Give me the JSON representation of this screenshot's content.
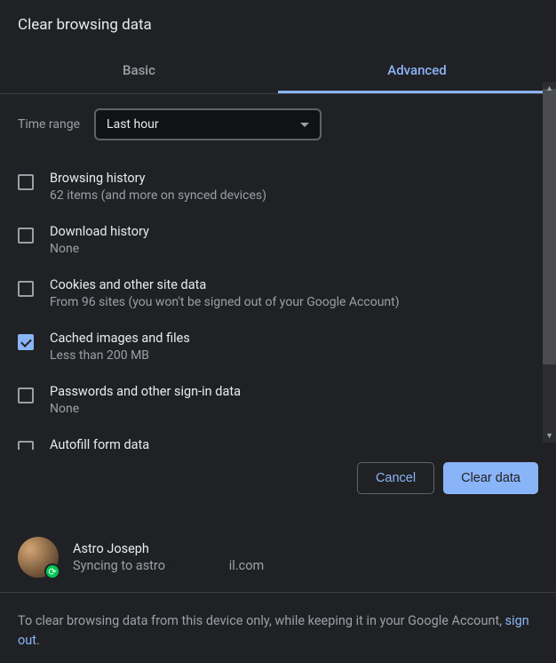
{
  "title": "Clear browsing data",
  "tabs": {
    "basic": "Basic",
    "advanced": "Advanced"
  },
  "time_range": {
    "label": "Time range",
    "value": "Last hour"
  },
  "items": [
    {
      "title": "Browsing history",
      "sub": "62 items (and more on synced devices)",
      "checked": false
    },
    {
      "title": "Download history",
      "sub": "None",
      "checked": false
    },
    {
      "title": "Cookies and other site data",
      "sub": "From 96 sites (you won't be signed out of your Google Account)",
      "checked": false
    },
    {
      "title": "Cached images and files",
      "sub": "Less than 200 MB",
      "checked": true
    },
    {
      "title": "Passwords and other sign-in data",
      "sub": "None",
      "checked": false
    },
    {
      "title": "Autofill form data",
      "sub": "",
      "checked": false
    }
  ],
  "buttons": {
    "cancel": "Cancel",
    "clear": "Clear data"
  },
  "account": {
    "name": "Astro Joseph",
    "sync_prefix": "Syncing to astro",
    "sync_suffix": "il.com"
  },
  "footer": {
    "text": "To clear browsing data from this device only, while keeping it in your Google Account, ",
    "link": "sign out",
    "period": "."
  }
}
